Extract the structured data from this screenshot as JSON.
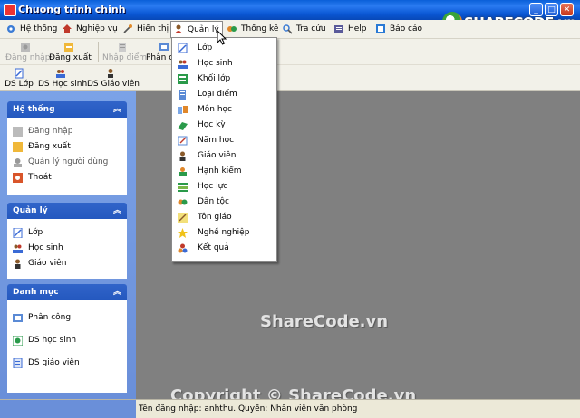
{
  "window": {
    "title": "Chuong trinh chinh"
  },
  "brand": {
    "logo_text": "SHARECODE.vn"
  },
  "menu": [
    {
      "label": "Hệ thống",
      "icon": "gear-icon",
      "color": "#3a7bd5"
    },
    {
      "label": "Nghiệp vụ",
      "icon": "home-icon",
      "color": "#c0392b"
    },
    {
      "label": "Hiển thị",
      "icon": "wand-icon",
      "color": "#e08a2a"
    },
    {
      "label": "Quản lý",
      "icon": "person-icon",
      "color": "#8a5a2a",
      "active": true
    },
    {
      "label": "Thống kê",
      "icon": "chart-icon",
      "color": "#2a9a4a"
    },
    {
      "label": "Tra cứu",
      "icon": "search-icon",
      "color": "#3a7bd5"
    },
    {
      "label": "Help",
      "icon": "help-icon",
      "color": "#5a5a9a"
    },
    {
      "label": "Báo cáo",
      "icon": "report-icon",
      "color": "#2a7ad5"
    }
  ],
  "toolbar1": [
    {
      "label": "Đăng nhập",
      "icon": "login-icon",
      "enabled": false
    },
    {
      "label": "Đăng xuất",
      "icon": "logout-icon",
      "enabled": true
    },
    {
      "label": "Nhập điểm",
      "icon": "grade-entry-icon",
      "enabled": false
    },
    {
      "label": "Phân c",
      "icon": "assign-icon",
      "enabled": true
    }
  ],
  "toolbar2": [
    {
      "label": "DS Lớp",
      "icon": "class-list-icon"
    },
    {
      "label": "DS Học sinh",
      "icon": "students-icon"
    },
    {
      "label": "DS Giáo viên",
      "icon": "teacher-icon"
    }
  ],
  "sidebar": {
    "groups": [
      {
        "title": "Hệ thống",
        "items": [
          {
            "label": "Đăng nhập",
            "icon": "login-icon",
            "dim": true
          },
          {
            "label": "Đăng xuất",
            "icon": "logout-icon"
          },
          {
            "label": "Quản lý người dùng",
            "icon": "users-admin-icon",
            "dim": true
          },
          {
            "label": "Thoát",
            "icon": "exit-icon"
          }
        ]
      },
      {
        "title": "Quản lý",
        "items": [
          {
            "label": "Lớp",
            "icon": "class-icon"
          },
          {
            "label": "Học sinh",
            "icon": "students-icon"
          },
          {
            "label": "Giáo viên",
            "icon": "teacher-icon"
          }
        ]
      },
      {
        "title": "Danh mục",
        "items": [
          {
            "label": "Phân công",
            "icon": "assign-icon"
          },
          {
            "label": "DS học sinh",
            "icon": "student-list-icon"
          },
          {
            "label": "DS giáo viên",
            "icon": "teacher-list-icon"
          }
        ]
      }
    ]
  },
  "dropdown": {
    "items": [
      {
        "label": "Lớp",
        "icon": "class-icon"
      },
      {
        "label": "Học sinh",
        "icon": "students-icon"
      },
      {
        "label": "Khối lớp",
        "icon": "grade-level-icon"
      },
      {
        "label": "Loại điểm",
        "icon": "score-type-icon"
      },
      {
        "label": "Môn học",
        "icon": "subject-icon"
      },
      {
        "label": "Học kỳ",
        "icon": "semester-icon"
      },
      {
        "label": "Năm học",
        "icon": "school-year-icon"
      },
      {
        "label": "Giáo viên",
        "icon": "teacher-icon"
      },
      {
        "label": "Hạnh kiểm",
        "icon": "conduct-icon"
      },
      {
        "label": "Học lực",
        "icon": "academic-icon"
      },
      {
        "label": "Dân tộc",
        "icon": "ethnicity-icon"
      },
      {
        "label": "Tôn giáo",
        "icon": "religion-icon"
      },
      {
        "label": "Nghề nghiệp",
        "icon": "occupation-icon"
      },
      {
        "label": "Kết quả",
        "icon": "result-icon"
      }
    ]
  },
  "watermarks": {
    "center": "ShareCode.vn",
    "bottom": "Copyright © ShareCode.vn"
  },
  "status": {
    "text": "Tên đăng nhập: anhthu.  Quyền: Nhân viên văn phòng"
  },
  "colors": {
    "title_bar": "#0a5fd8",
    "sidebar": "#6a8fd9",
    "workspace": "#808080",
    "group_header": "#2458bf"
  }
}
